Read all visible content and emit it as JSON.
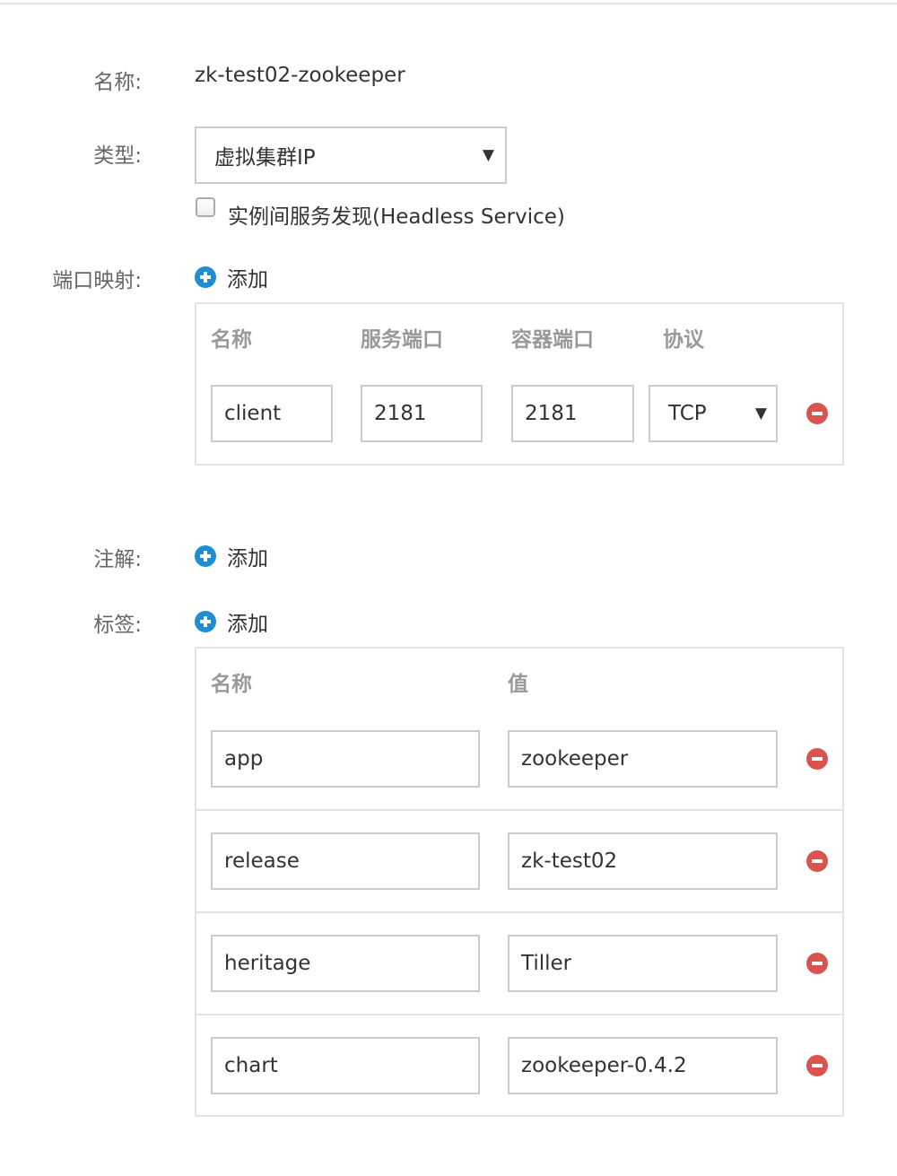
{
  "form": {
    "name_label": "名称:",
    "name_value": "zk-test02-zookeeper",
    "type_label": "类型:",
    "type_selected": "虚拟集群IP",
    "headless_label": "实例间服务发现(Headless Service)",
    "port_mapping_label": "端口映射:",
    "annotations_label": "注解:",
    "labels_label": "标签:",
    "add_text": "添加"
  },
  "ports": {
    "headers": {
      "name": "名称",
      "service_port": "服务端口",
      "container_port": "容器端口",
      "protocol": "协议"
    },
    "rows": [
      {
        "name": "client",
        "service_port": "2181",
        "container_port": "2181",
        "protocol": "TCP"
      }
    ]
  },
  "labels": {
    "headers": {
      "name": "名称",
      "value": "值"
    },
    "rows": [
      {
        "name": "app",
        "value": "zookeeper"
      },
      {
        "name": "release",
        "value": "zk-test02"
      },
      {
        "name": "heritage",
        "value": "Tiller"
      },
      {
        "name": "chart",
        "value": "zookeeper-0.4.2"
      }
    ]
  },
  "icons": {
    "add": "plus-circle-icon",
    "remove": "minus-circle-icon",
    "dropdown": "caret-down-icon"
  },
  "colors": {
    "add_icon": "#1b8fd2",
    "remove_icon": "#d9534f",
    "border": "#cccccc",
    "panel_border": "#e3e3e3",
    "header_text": "#999999"
  }
}
